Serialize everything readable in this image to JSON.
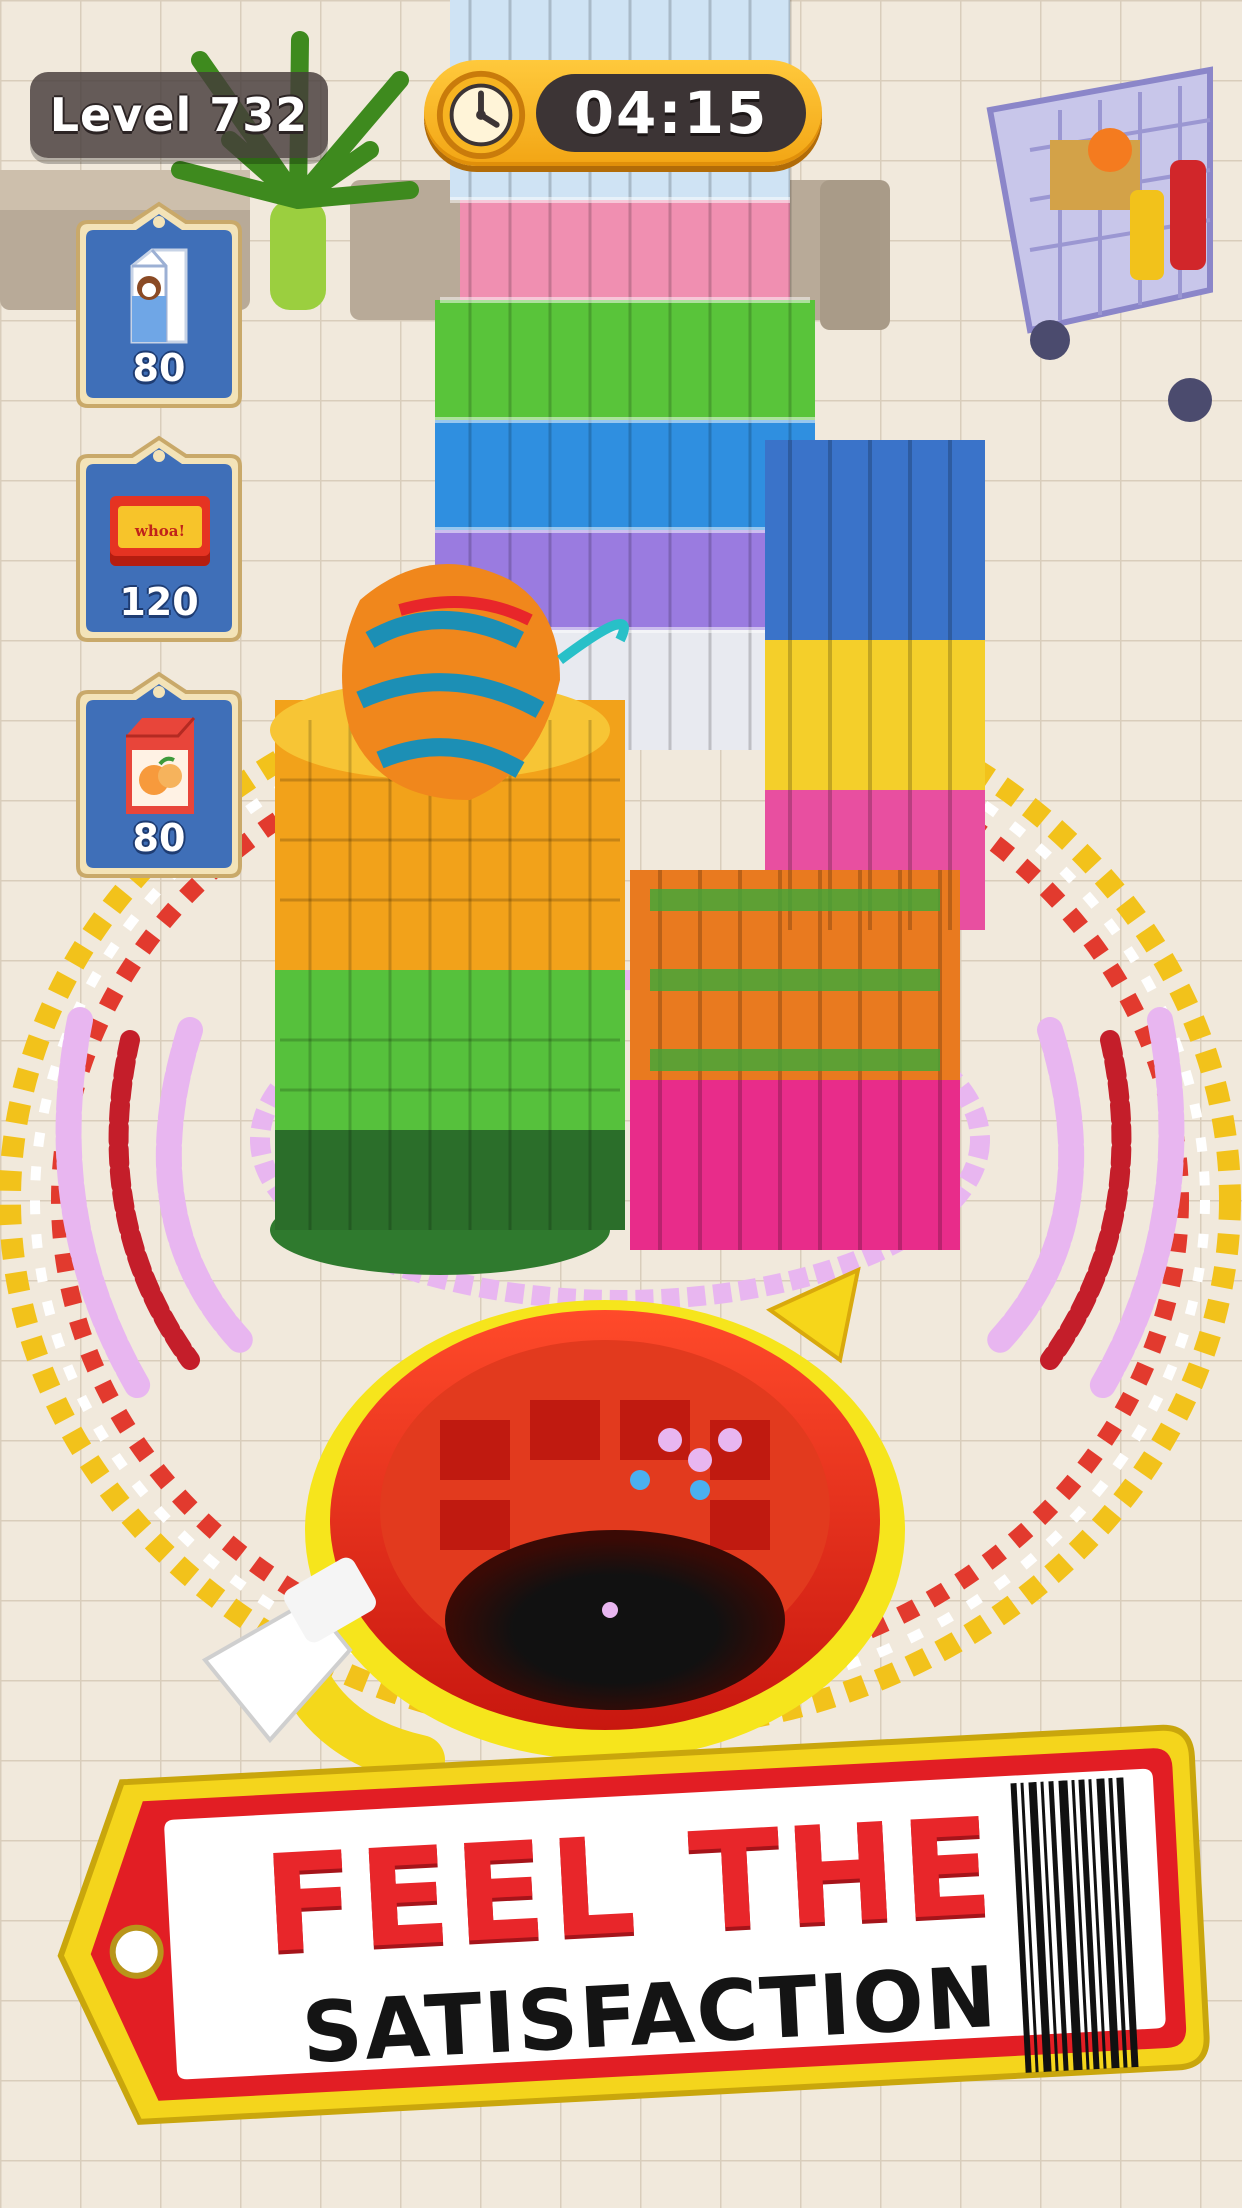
{
  "hud": {
    "level_label": "Level 732",
    "timer": "04:15"
  },
  "goals": [
    {
      "icon": "milk-carton-icon",
      "count": "80"
    },
    {
      "icon": "snack-box-icon",
      "box_text": "whoa!",
      "count": "120"
    },
    {
      "icon": "juice-carton-icon",
      "count": "80"
    }
  ],
  "banner": {
    "line1": "FEEL THE",
    "line2": "SATISFACTION"
  },
  "colors": {
    "accent_red": "#e8262a",
    "timer_gold": "#f7b421",
    "card_blue": "#3f6fb8",
    "floor": "#efe6d8"
  }
}
